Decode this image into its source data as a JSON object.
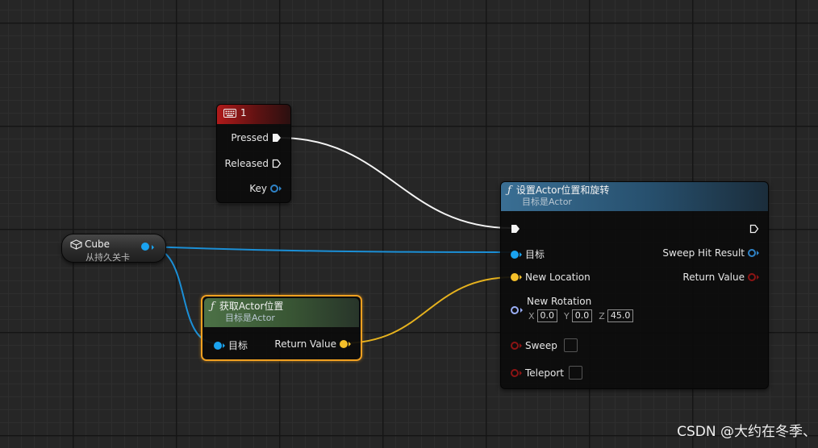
{
  "key_node": {
    "title": "1",
    "pins": [
      "Pressed",
      "Released",
      "Key"
    ]
  },
  "cube_node": {
    "title": "Cube",
    "subtitle": "从持久关卡"
  },
  "set_node": {
    "title": "设置Actor位置和旋转",
    "subtitle": "目标是Actor",
    "inputs": {
      "target": "目标",
      "new_location": "New Location",
      "new_rotation": "New Rotation",
      "sweep": "Sweep",
      "teleport": "Teleport"
    },
    "outputs": {
      "sweep_hit_result": "Sweep Hit Result",
      "return_value": "Return Value"
    },
    "rotation": {
      "x_label": "X",
      "x": "0.0",
      "y_label": "Y",
      "y": "0.0",
      "z_label": "Z",
      "z": "45.0"
    }
  },
  "get_node": {
    "title": "获取Actor位置",
    "subtitle": "目标是Actor",
    "input": "目标",
    "output": "Return Value"
  },
  "watermark": "CSDN @大约在冬季、",
  "colors": {
    "exec": "#ffffff",
    "object": "#1aa3f0",
    "vector": "#f5c02a",
    "rotator": "#9aaef5",
    "struct": "#2f83c7",
    "bool": "#8c1414"
  },
  "icons": {
    "keyboard": "keyboard-icon",
    "cube": "cube-icon",
    "function": "function-icon"
  }
}
